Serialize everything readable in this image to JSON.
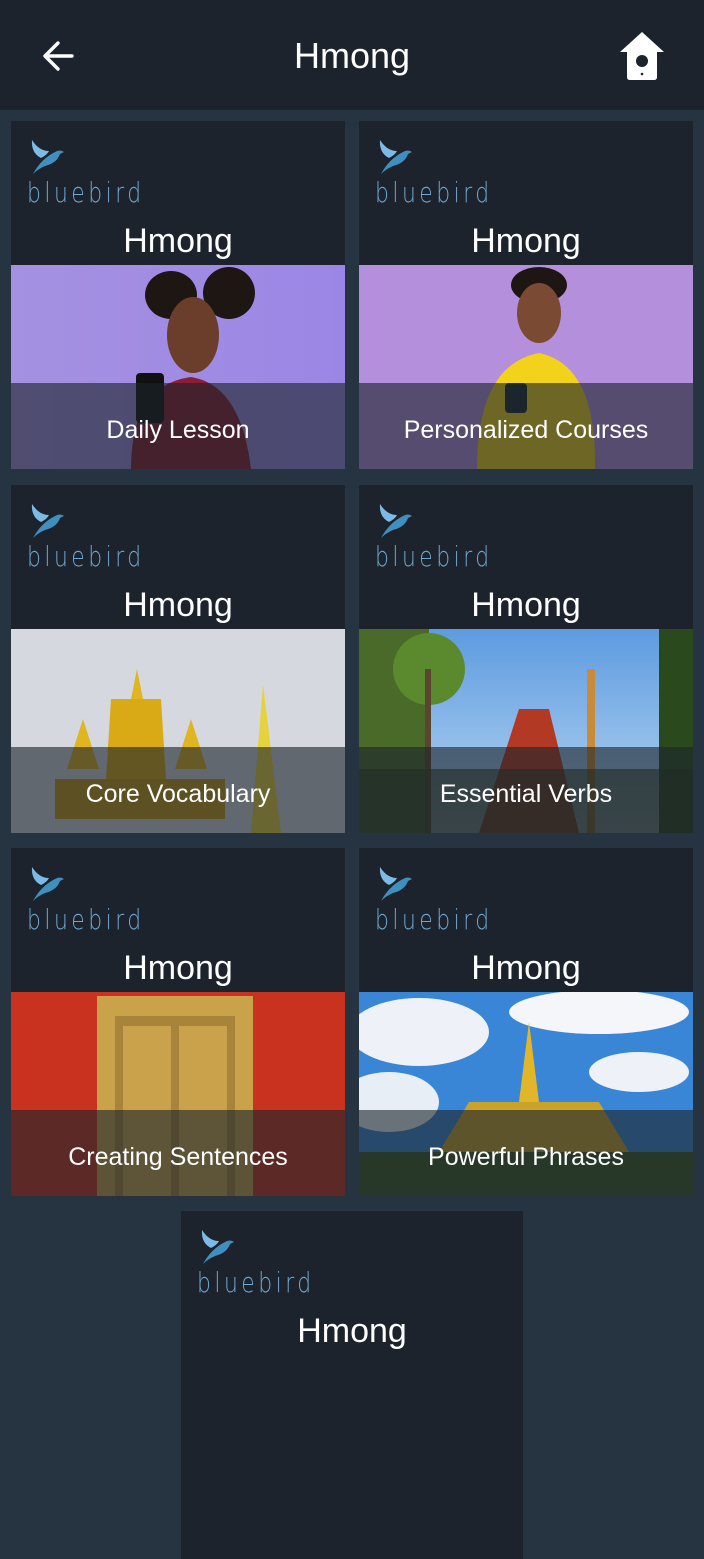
{
  "header": {
    "title": "Hmong",
    "back_icon": "arrow-left-icon",
    "home_icon": "birdhouse-home-icon"
  },
  "brand": {
    "logo_text": "bluebird",
    "logo_icon": "bluebird-logo-icon",
    "logo_color": "#6fa7cf"
  },
  "cards": [
    {
      "language": "Hmong",
      "label": "Daily Lesson",
      "image": "woman-with-phone-purple-background"
    },
    {
      "language": "Hmong",
      "label": "Personalized Courses",
      "image": "young-man-yellow-sweater-purple-background"
    },
    {
      "language": "Hmong",
      "label": "Core Vocabulary",
      "image": "golden-temple-spires"
    },
    {
      "language": "Hmong",
      "label": "Essential Verbs",
      "image": "temple-with-palm-trees"
    },
    {
      "language": "Hmong",
      "label": "Creating Sentences",
      "image": "golden-carved-door-red-wall"
    },
    {
      "language": "Hmong",
      "label": "Powerful Phrases",
      "image": "golden-stupa-blue-sky"
    },
    {
      "language": "Hmong",
      "label": "",
      "image": ""
    }
  ],
  "colors": {
    "background": "#263340",
    "card": "#1c232c",
    "topbar": "#1c232c"
  }
}
